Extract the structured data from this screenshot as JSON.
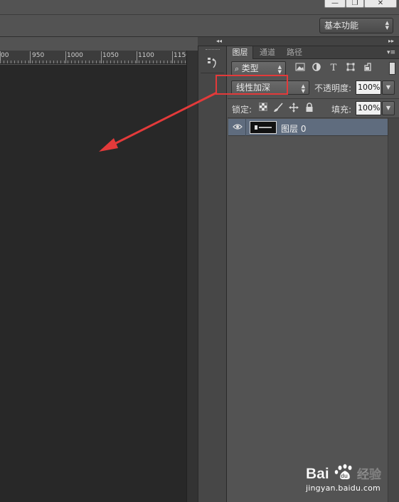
{
  "window": {
    "min_label": "—",
    "restore_label": "❐",
    "close_label": "✕"
  },
  "options_bar": {
    "workspace_label": "基本功能"
  },
  "ruler": {
    "ticks": [
      "00",
      "950",
      "1000",
      "1050",
      "1100",
      "1150"
    ]
  },
  "icon_strip": {
    "history_icon": "history-brush-icon",
    "collapse_label": "◂◂"
  },
  "layers_panel": {
    "collapse_label": "▸▸",
    "tabs": [
      {
        "label": "图层",
        "active": true
      },
      {
        "label": "通道",
        "active": false
      },
      {
        "label": "路径",
        "active": false
      }
    ],
    "menu_icon": "panel-menu-icon",
    "filter": {
      "kind_label": "类型",
      "icons": [
        "image-filter-icon",
        "adjustment-filter-icon",
        "type-filter-icon",
        "shape-filter-icon",
        "smart-object-filter-icon"
      ]
    },
    "blend_mode": "线性加深",
    "opacity_label": "不透明度:",
    "opacity_value": "100%",
    "lock_label": "锁定:",
    "lock_icons": [
      "lock-transparent-icon",
      "lock-image-icon",
      "lock-position-icon",
      "lock-all-icon"
    ],
    "fill_label": "填充:",
    "fill_value": "100%",
    "layers": [
      {
        "name": "图层 0",
        "visible": true,
        "selected": true
      }
    ]
  },
  "annotation": {
    "highlight_color": "#e33a3a",
    "arrow_color": "#e33a3a"
  },
  "watermark": {
    "logo": "Baidu 经验",
    "url": "jingyan.baidu.com"
  }
}
